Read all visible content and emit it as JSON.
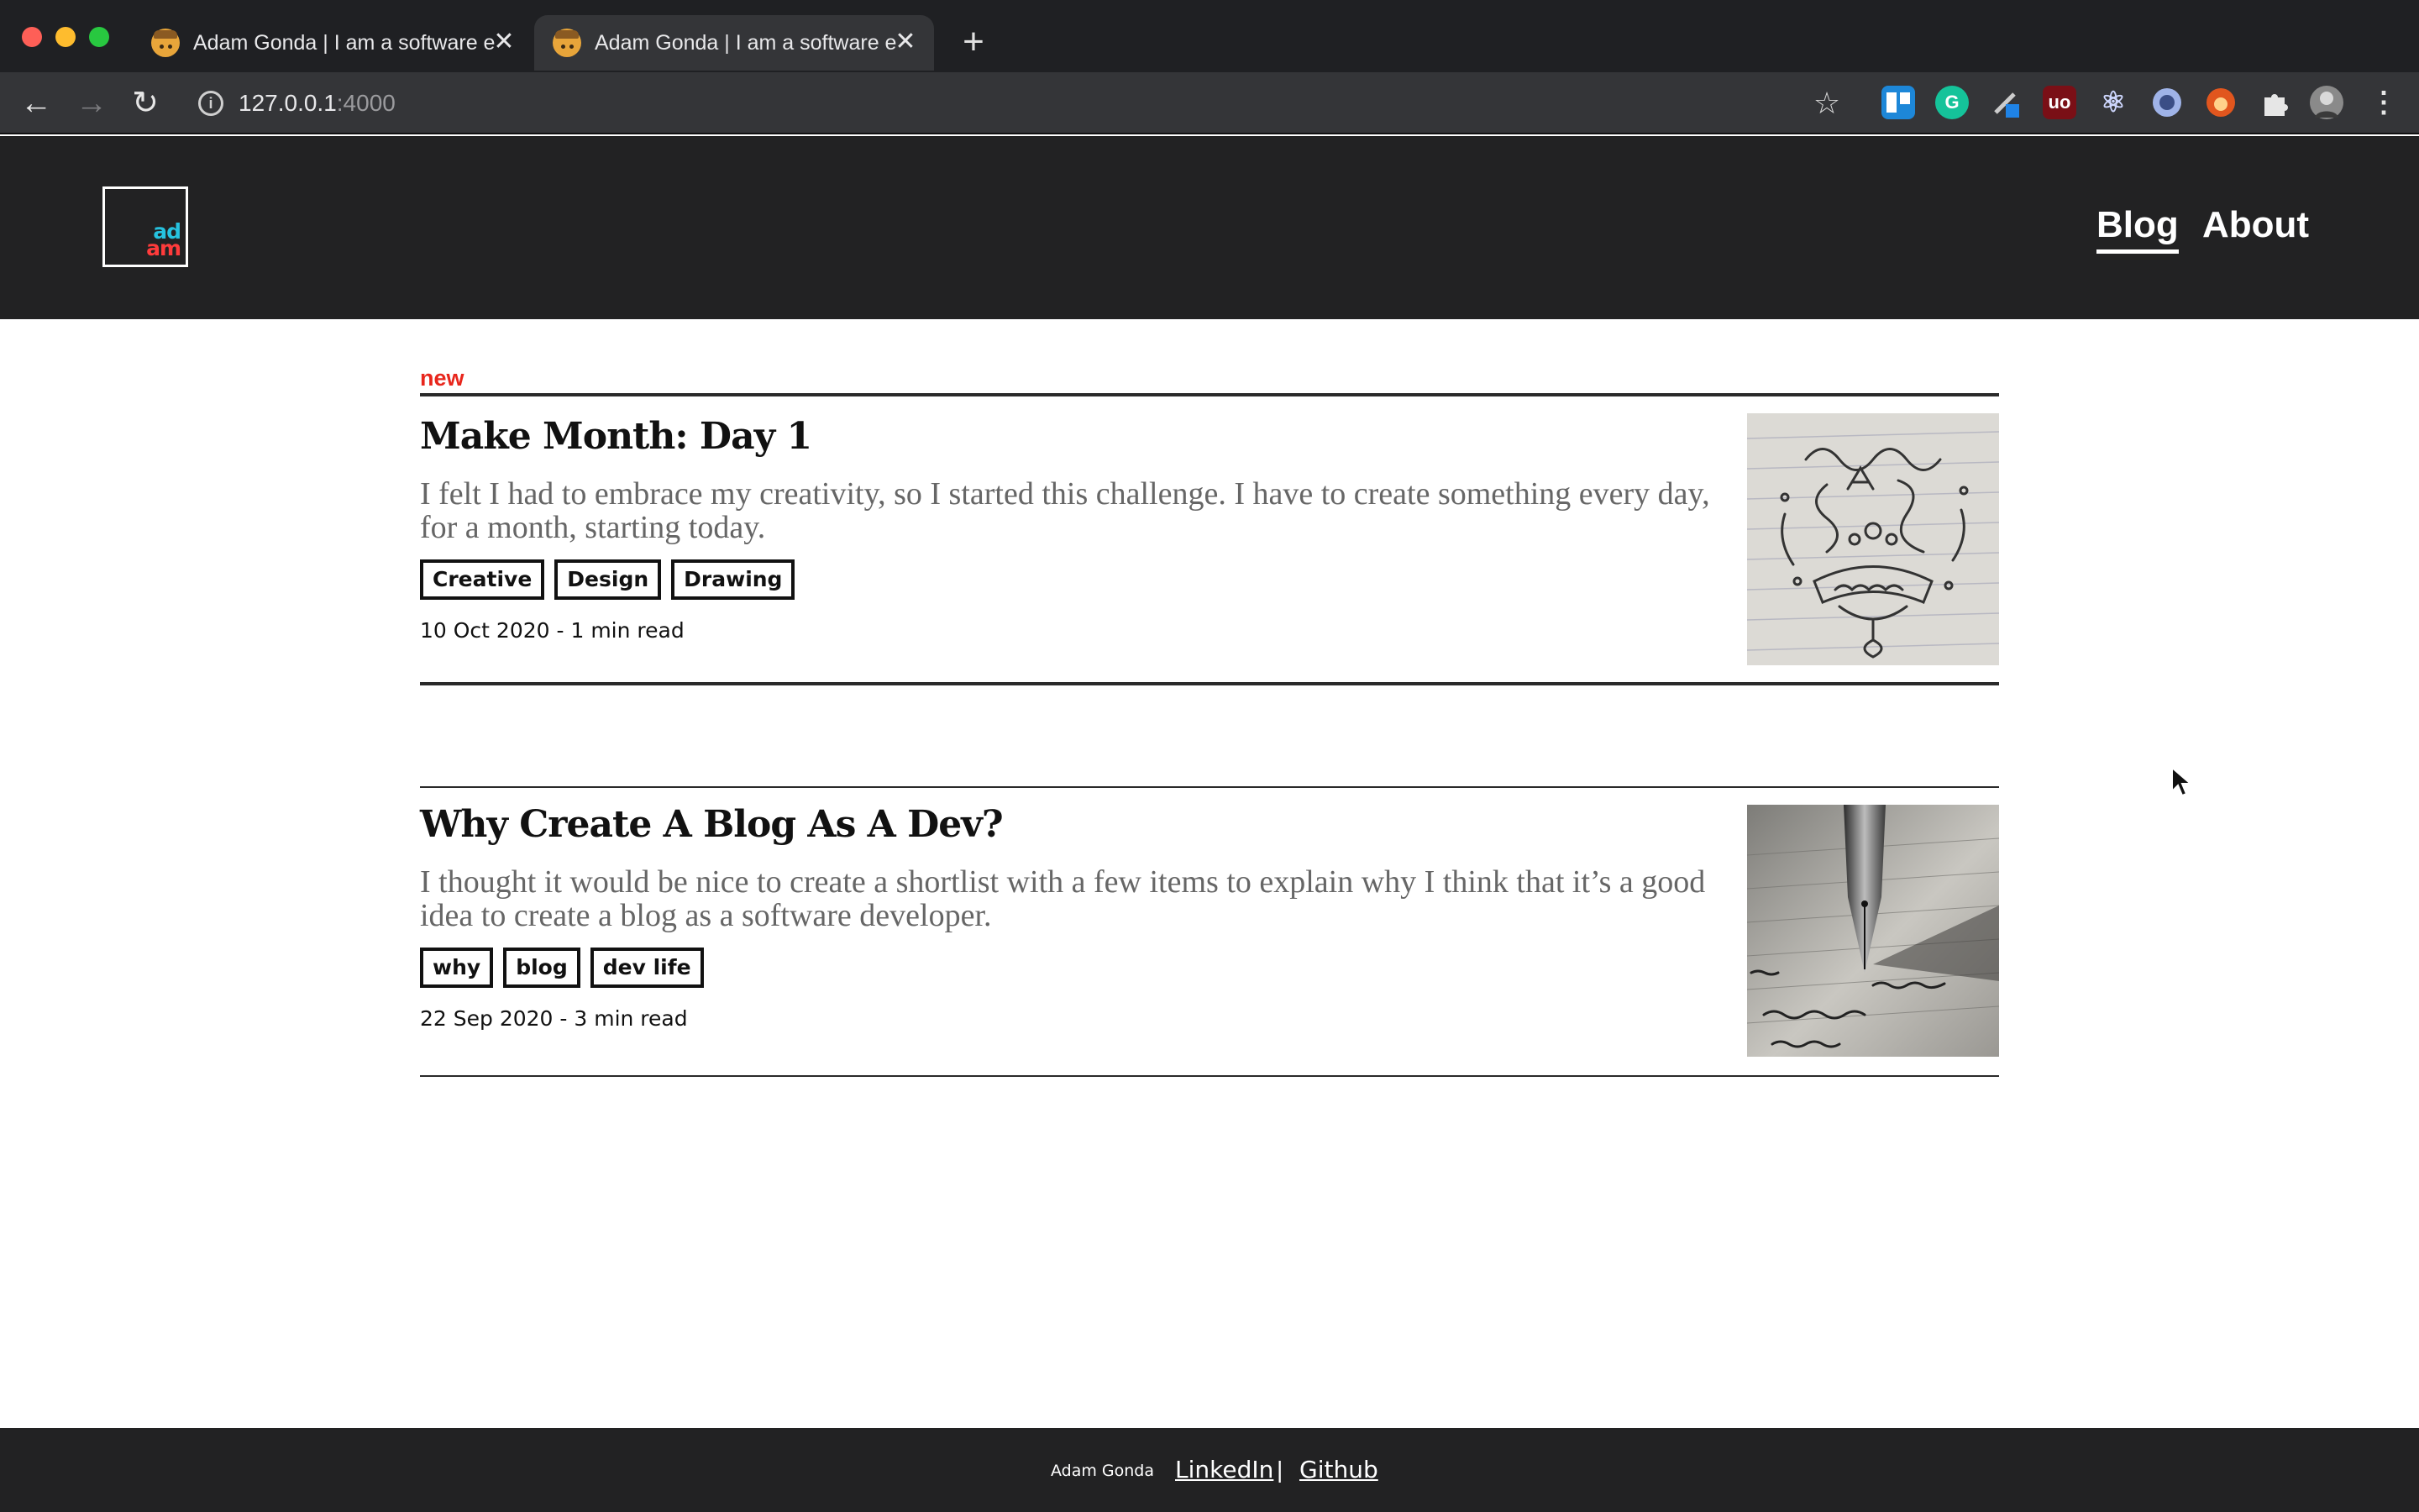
{
  "browser": {
    "tabs": [
      {
        "title": "Adam Gonda | I am a software engineer",
        "active": false
      },
      {
        "title": "Adam Gonda | I am a software engineer",
        "active": true
      }
    ],
    "url": {
      "host": "127.0.0.1",
      "port": ":4000"
    },
    "extensions": [
      "trello-icon",
      "grammarly-icon",
      "eyedropper-icon",
      "ublock-icon",
      "react-devtools-icon",
      "1password-icon",
      "fox-icon",
      "puzzle-icon",
      "profile-avatar"
    ],
    "ext_labels": {
      "grammarly": "G",
      "ublock": "uo"
    }
  },
  "site": {
    "logo": {
      "line1": "ad",
      "line2": "am"
    },
    "nav": {
      "blog": "Blog",
      "about": "About"
    }
  },
  "posts": [
    {
      "badge": "new",
      "title": "Make Month: Day 1",
      "description": "I felt I had to embrace my creativity, so I started this challenge. I have to create something every day, for a month, starting today.",
      "tags": [
        "Creative",
        "Design",
        "Drawing"
      ],
      "meta": "10 Oct 2020 - 1 min read",
      "image": "doodle-sketch-image"
    },
    {
      "title": "Why Create A Blog As A Dev?",
      "description": "I thought it would be nice to create a shortlist with a few items to explain why I think that it’s a good idea to create a blog as a software developer.",
      "tags": [
        "why",
        "blog",
        "dev life"
      ],
      "meta": "22 Sep 2020 - 3 min read",
      "image": "fountain-pen-image"
    }
  ],
  "footer": {
    "name": "Adam Gonda",
    "links": {
      "linkedin": "LinkedIn",
      "github": "Github"
    },
    "separator": "|"
  },
  "colors": {
    "header_bg": "#222223",
    "new_badge": "#e8261c",
    "logo_blue": "#26c2df",
    "logo_red": "#ff3b3b"
  }
}
